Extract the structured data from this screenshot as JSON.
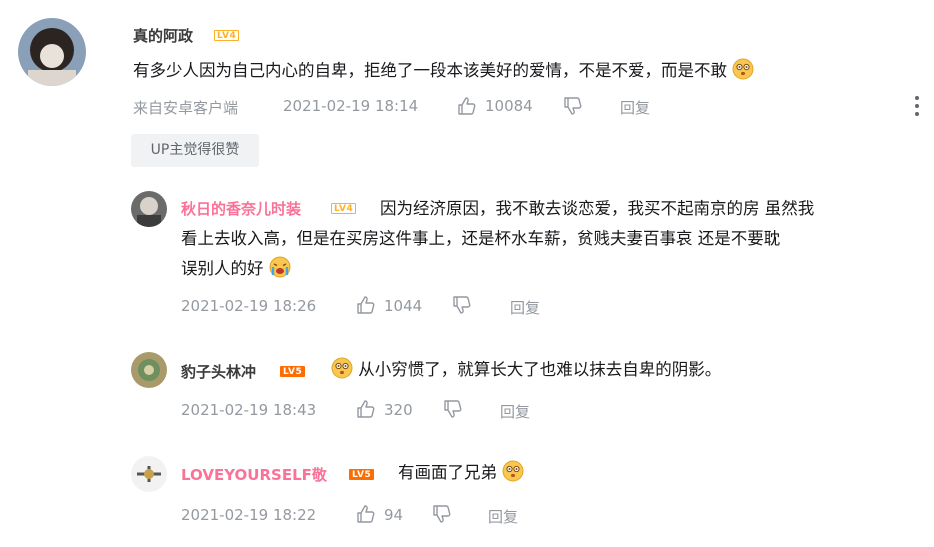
{
  "comment": {
    "username": "真的阿政",
    "level": "LV4",
    "text": "有多少人因为自己内心的自卑，拒绝了一段本该美好的爱情，不是不爱，而是不敢",
    "source": "来自安卓客户端",
    "time": "2021-02-19 18:14",
    "likes": "10084",
    "reply_label": "回复",
    "up_tag": "UP主觉得很赞"
  },
  "replies": [
    {
      "username": "秋日的香奈儿时装",
      "level": "LV4",
      "text_line1": "因为经济原因，我不敢去谈恋爱，我买不起南京的房 虽然我",
      "text_line2": "看上去收入高，但是在买房这件事上，还是杯水车薪，贫贱夫妻百事哀 还是不要耽",
      "text_line3": "误别人的好",
      "time": "2021-02-19 18:26",
      "likes": "1044",
      "reply_label": "回复"
    },
    {
      "username": "豹子头林冲",
      "level": "LV5",
      "text": "从小穷惯了，就算长大了也难以抹去自卑的阴影。",
      "time": "2021-02-19 18:43",
      "likes": "320",
      "reply_label": "回复"
    },
    {
      "username": "LOVEYOURSELF敬",
      "level": "LV5",
      "text": "有画面了兄弟",
      "time": "2021-02-19 18:22",
      "likes": "94",
      "reply_label": "回复"
    }
  ],
  "icons": [
    "thumb-up-icon",
    "thumb-down-icon",
    "more-icon",
    "emoji-dazed-icon",
    "emoji-crying-icon"
  ],
  "colors": {
    "pink_username": "#fb7299",
    "meta_gray": "#9499a0",
    "lv4": "#ffb027",
    "lv5": "#ff6c00"
  }
}
